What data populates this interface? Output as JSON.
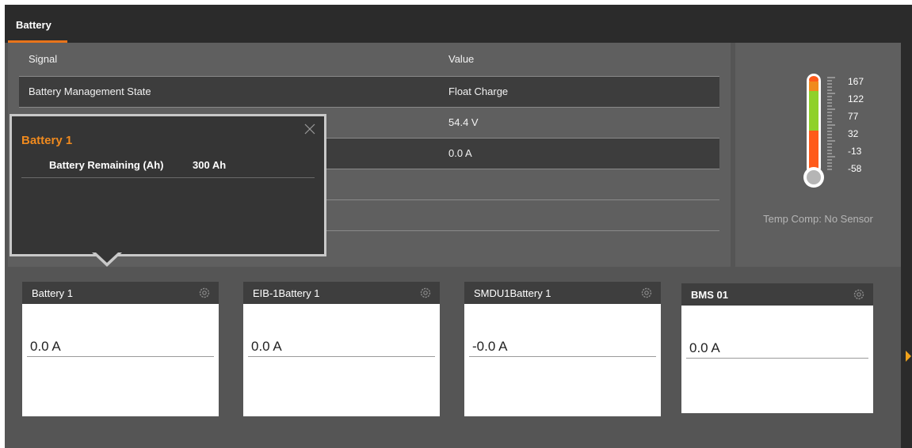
{
  "tab": {
    "label": "Battery"
  },
  "table": {
    "headers": {
      "signal": "Signal",
      "value": "Value"
    },
    "rows": [
      {
        "signal": "Battery Management State",
        "value": "Float Charge"
      },
      {
        "signal": "",
        "value": "54.4 V"
      },
      {
        "signal": "",
        "value": "0.0 A"
      },
      {
        "signal": "",
        "value": ""
      },
      {
        "signal": "",
        "value": ""
      }
    ]
  },
  "thermometer": {
    "scale": [
      "167",
      "122",
      "77",
      "32",
      "-13",
      "-58"
    ],
    "status_text": "Temp Comp: No Sensor",
    "colors": {
      "hot": "#ff5a1a",
      "warm": "#f08a1e",
      "normal": "#8fd12a",
      "bulb": "#b5b5b5"
    }
  },
  "popup": {
    "title": "Battery 1",
    "label": "Battery Remaining (Ah)",
    "value": "300 Ah"
  },
  "cards": [
    {
      "title": "Battery 1",
      "value": "0.0 A"
    },
    {
      "title": "EIB-1Battery 1",
      "value": "0.0 A"
    },
    {
      "title": "SMDU1Battery 1",
      "value": "-0.0 A"
    },
    {
      "title": "BMS 01",
      "value": "0.0 A"
    }
  ],
  "colors": {
    "accent": "#e8741b",
    "popup_title": "#f08a1e"
  }
}
